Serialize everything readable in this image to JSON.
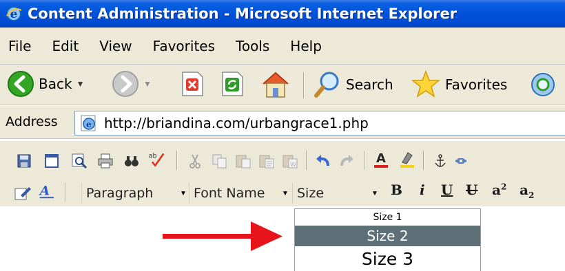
{
  "window": {
    "title": "Content Administration - Microsoft Internet Explorer",
    "title_icon": "ie-logo-icon"
  },
  "menubar": {
    "items": [
      "File",
      "Edit",
      "View",
      "Favorites",
      "Tools",
      "Help"
    ]
  },
  "toolbar": {
    "back_label": "Back",
    "search_label": "Search",
    "favorites_label": "Favorites"
  },
  "address": {
    "label": "Address",
    "url": "http://briandina.com/urbangrace1.php"
  },
  "editor": {
    "paragraph_value": "Paragraph",
    "font_value": "Font Name",
    "size_value": "Size",
    "bold_glyph": "B",
    "italic_glyph": "i",
    "underline_glyph": "U",
    "strike_glyph": "U",
    "superscript_glyph": "a",
    "subscript_glyph": "a",
    "sup_mark": "2",
    "sub_mark": "2"
  },
  "size_dropdown": {
    "options": [
      "Size 1",
      "Size 2",
      "Size 3"
    ],
    "highlighted": "Size 2"
  },
  "colors": {
    "titlebar": "#0052d8",
    "chrome": "#ece9d8",
    "highlight": "#5f6f78",
    "annotation_arrow": "#e8141b"
  }
}
